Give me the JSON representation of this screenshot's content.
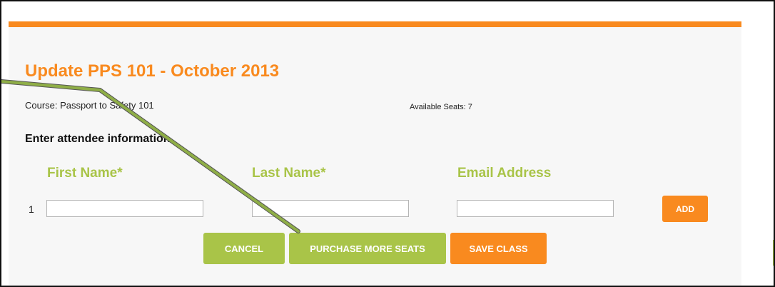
{
  "page": {
    "title": "Update PPS 101 - October 2013",
    "course_label": "Course: Passport to Safety 101",
    "available_seats_label": "Available Seats: 7",
    "section_heading": "Enter attendee information"
  },
  "form": {
    "columns": [
      "First Name*",
      "Last Name*",
      "Email Address"
    ],
    "rows": [
      {
        "number": "1",
        "first_name": "",
        "last_name": "",
        "email": ""
      }
    ],
    "add_label": "ADD"
  },
  "actions": {
    "cancel_label": "CANCEL",
    "purchase_label": "PURCHASE MORE SEATS",
    "save_label": "SAVE CLASS"
  },
  "colors": {
    "accent_orange": "#f98a1f",
    "accent_green": "#a9c448",
    "annotation_arrow": "#8fae47"
  }
}
